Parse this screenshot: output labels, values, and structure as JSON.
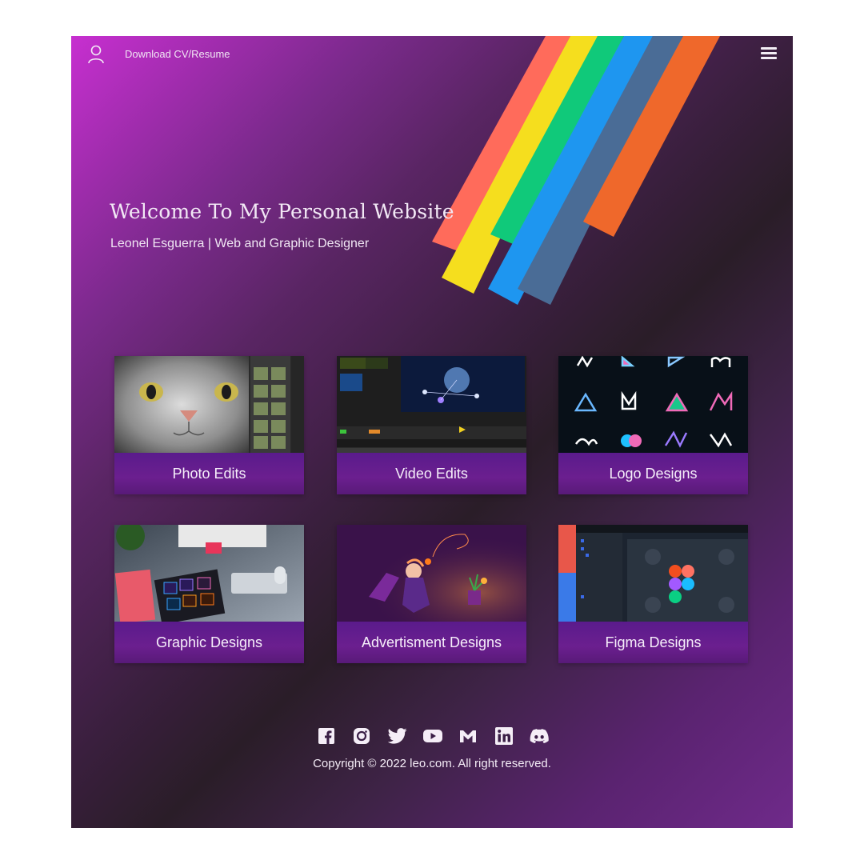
{
  "header": {
    "download_label": "Download CV/Resume",
    "user_icon": "user-icon",
    "menu_icon": "hamburger-menu-icon"
  },
  "hero": {
    "title": "Welcome To My Personal Website",
    "subtitle": "Leonel Esguerra | Web and Graphic Designer"
  },
  "stripe_colors": [
    "#ff6b5b",
    "#f5de1e",
    "#10c97a",
    "#1e96f0",
    "#4a6c96",
    "#ef682b"
  ],
  "cards": [
    {
      "label": "Photo Edits"
    },
    {
      "label": "Video Edits"
    },
    {
      "label": "Logo Designs"
    },
    {
      "label": "Graphic Designs"
    },
    {
      "label": "Advertisment Designs"
    },
    {
      "label": "Figma Designs"
    }
  ],
  "socials": [
    {
      "icon": "facebook-icon"
    },
    {
      "icon": "instagram-icon"
    },
    {
      "icon": "twitter-icon"
    },
    {
      "icon": "youtube-icon"
    },
    {
      "icon": "gmail-icon"
    },
    {
      "icon": "linkedin-icon"
    },
    {
      "icon": "discord-icon"
    }
  ],
  "footer": {
    "copyright": "Copyright © 2022 leo.com. All right reserved."
  }
}
